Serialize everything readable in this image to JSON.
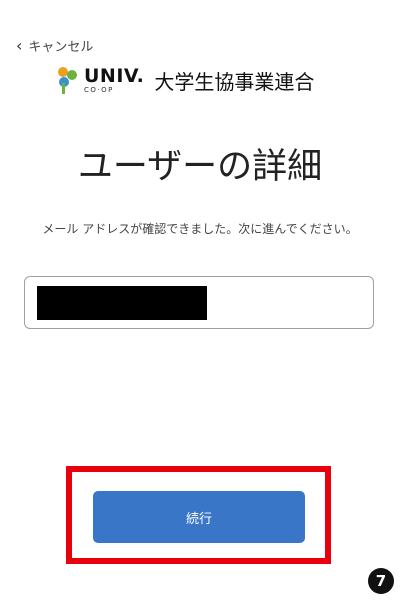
{
  "header": {
    "cancel_label": "キャンセル",
    "cancel_icon": "chevron-left-icon"
  },
  "logo": {
    "wordmark": "UNIV.",
    "sub": "CO·OP",
    "org_name": "大学生協事業連合"
  },
  "main": {
    "title": "ユーザーの詳細",
    "message": "メール アドレスが確認できました。次に進んでください。",
    "email_field_value_redacted": true
  },
  "footer": {
    "continue_label": "続行",
    "step_number": "7"
  },
  "colors": {
    "button": "#3a76c8",
    "highlight": "#e8000d"
  }
}
